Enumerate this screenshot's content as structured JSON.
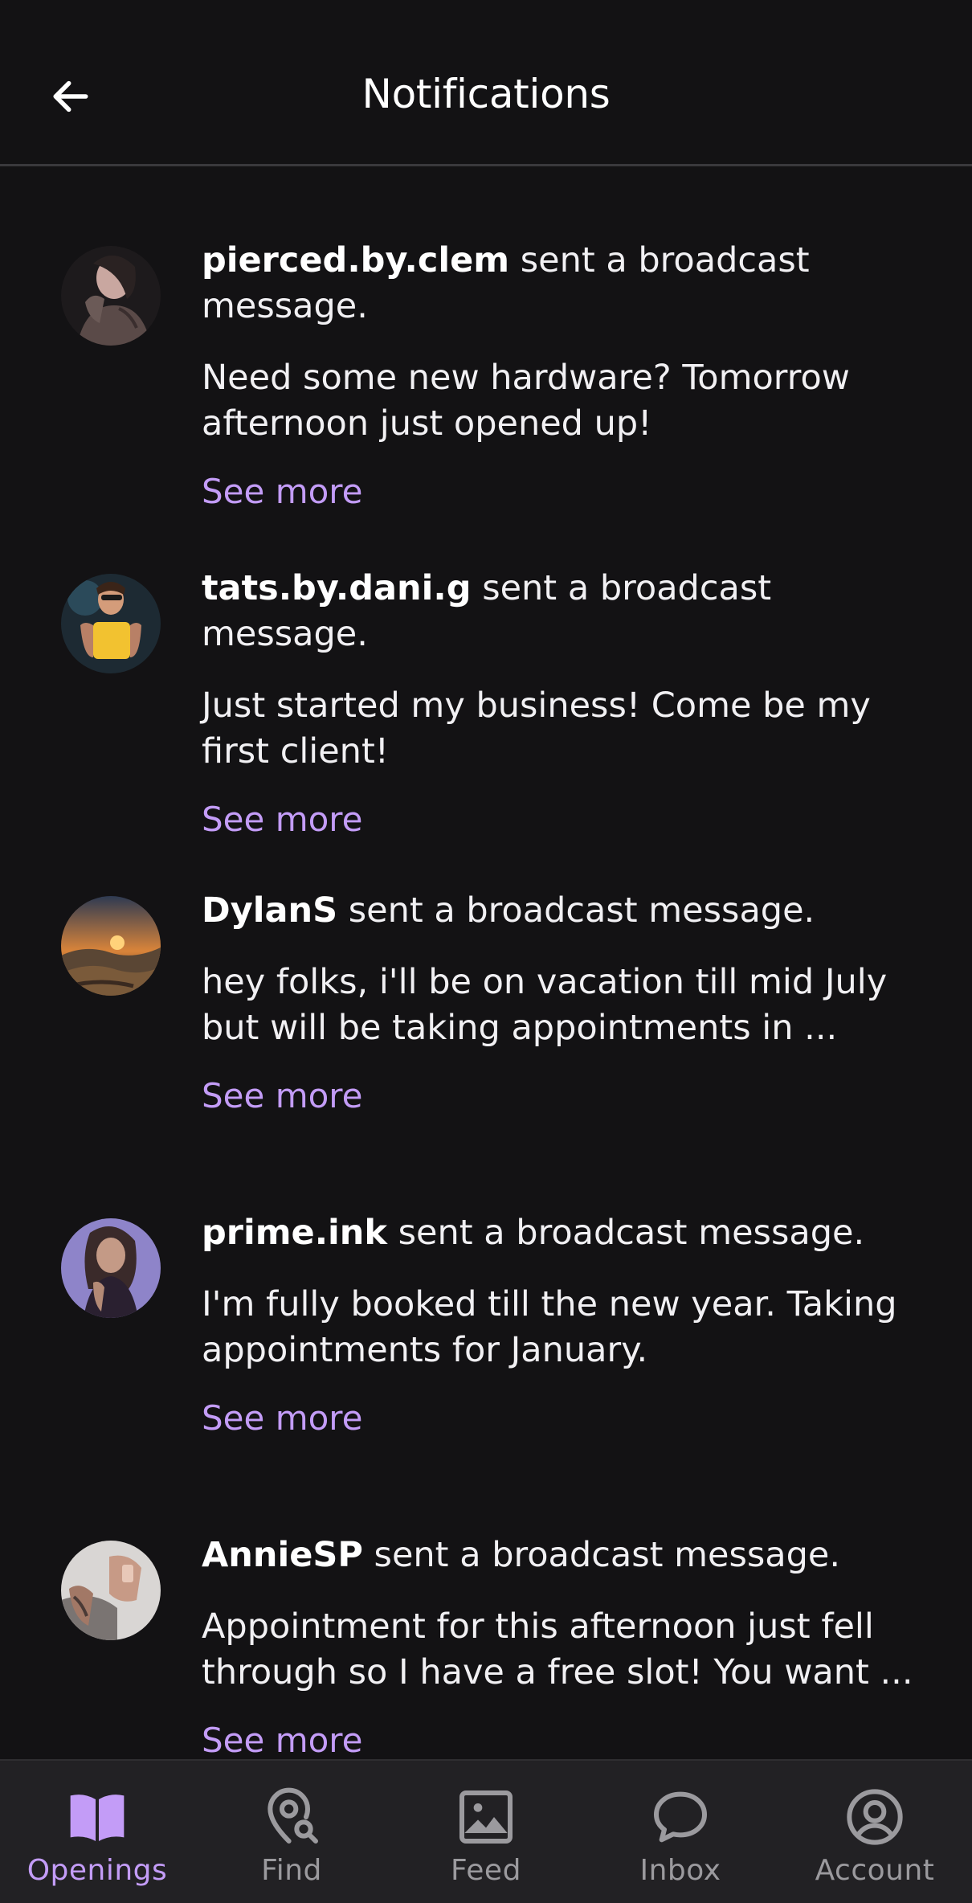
{
  "header": {
    "title": "Notifications",
    "back_icon": "arrow-left-icon"
  },
  "notifications": [
    {
      "user": "pierced.by.clem",
      "action": " sent a broadcast message.",
      "message": "Need some new hardware? Tomorrow afternoon just opened up!",
      "see_more": "See more",
      "avatar_colors": [
        "#1d1a1c",
        "#6b5a57",
        "#c9a7a0"
      ]
    },
    {
      "user": "tats.by.dani.g",
      "action": " sent a broadcast message.",
      "message": "Just started my business! Come be my first client!",
      "see_more": "See more",
      "avatar_colors": [
        "#1d2a33",
        "#f2c230",
        "#d49c7a"
      ]
    },
    {
      "user": "DylanS",
      "action": " sent a broadcast message.",
      "message": "hey folks, i'll be on vacation till mid July but will be taking appointments in ...",
      "see_more": "See more",
      "avatar_colors": [
        "#2e3a52",
        "#f0a23a",
        "#7a5a3a"
      ]
    },
    {
      "user": "prime.ink",
      "action": " sent a broadcast message.",
      "message": "I'm fully booked till the new year. Taking appointments for January.",
      "see_more": "See more",
      "avatar_colors": [
        "#8e84c9",
        "#3a2a2a",
        "#c49a86"
      ]
    },
    {
      "user": "AnnieSP",
      "action": " sent a broadcast message.",
      "message": "Appointment for this afternoon just fell through so I have a free slot! You want ...",
      "see_more": "See more",
      "avatar_colors": [
        "#d9d6d4",
        "#7a7472",
        "#c79a86"
      ]
    }
  ],
  "bottom_nav": {
    "active": "Openings",
    "accent_color": "#c39cf7",
    "items": [
      {
        "label": "Openings",
        "icon": "book-icon"
      },
      {
        "label": "Find",
        "icon": "map-pin-search-icon"
      },
      {
        "label": "Feed",
        "icon": "image-icon"
      },
      {
        "label": "Inbox",
        "icon": "chat-bubble-icon"
      },
      {
        "label": "Account",
        "icon": "user-circle-icon"
      }
    ]
  }
}
